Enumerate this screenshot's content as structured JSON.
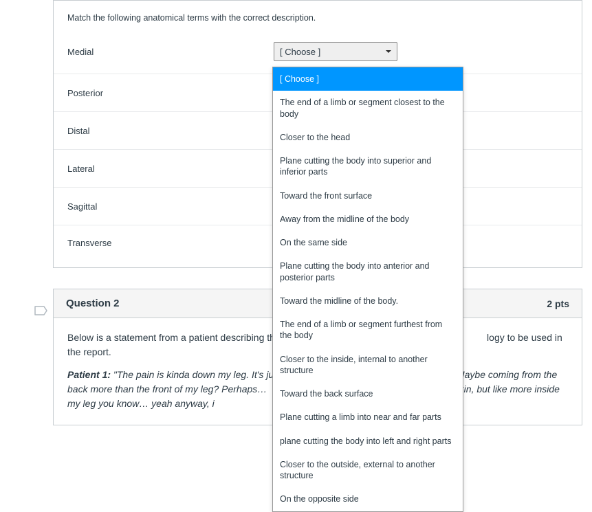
{
  "question1": {
    "instructions": "Match the following anatomical terms with the correct description.",
    "terms": [
      "Medial",
      "Posterior",
      "Distal",
      "Lateral",
      "Sagittal",
      "Transverse"
    ],
    "select_placeholder": "[ Choose ]",
    "dropdown_options": [
      "[ Choose ]",
      "The end of a limb or segment closest to the body",
      "Closer to the head",
      "Plane cutting the body into superior and inferior parts",
      "Toward the front surface",
      "Away from the midline of the body",
      "On the same side",
      "Plane cutting the body into anterior and posterior parts",
      "Toward the midline of the body.",
      "The end of a limb or segment furthest from the body",
      "Closer to the inside, internal to another structure",
      "Toward the back surface",
      "Plane cutting a limb into near and far parts",
      "plane cutting the body into left and right parts",
      "Closer to the outside, external to another structure",
      "On the opposite side"
    ]
  },
  "question2": {
    "title": "Question 2",
    "points": "2 pts",
    "intro_pre": "Below is a statement from a patient describing thei",
    "intro_post": "logy to be used in the report.",
    "patient_label": "Patient 1:",
    "patient_quote_pre": " \"The pain is kinda down my leg. It's just ",
    "patient_quote_mid1": "'t know. Maybe coming from the back more than the front of my leg? Perhaps…",
    "patient_quote_mid2": "ck, but like not on the skin, but like more inside my leg you know… yeah anyway, i"
  }
}
